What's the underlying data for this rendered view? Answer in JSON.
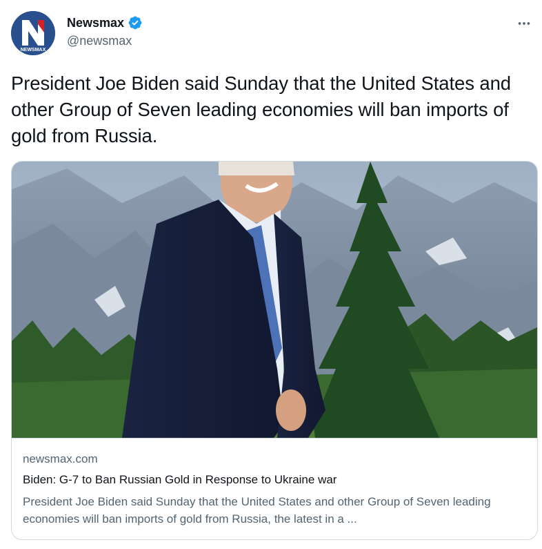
{
  "author": {
    "display_name": "Newsmax",
    "handle": "@newsmax",
    "avatar_letter": "N",
    "avatar_wordmark": "NEWSMAX",
    "verified": true
  },
  "tweet": {
    "text": "President Joe Biden said Sunday that the United States and other Group of Seven leading economies will ban imports of gold from Russia."
  },
  "card": {
    "domain": "newsmax.com",
    "title": "Biden: G-7 to Ban Russian Gold in Response to Ukraine war",
    "description": "President Joe Biden said Sunday that the United States and other Group of Seven leading economies will ban imports of gold from Russia, the latest in a ..."
  },
  "colors": {
    "brand_blue": "#1d9bf0",
    "avatar_bg": "#2a4f8f",
    "avatar_red": "#d6202a",
    "text_primary": "#0f1419",
    "text_secondary": "#536471",
    "border": "#cfd9de"
  },
  "icons": {
    "verified": "verified-badge-icon",
    "more": "more-horizontal-icon"
  }
}
